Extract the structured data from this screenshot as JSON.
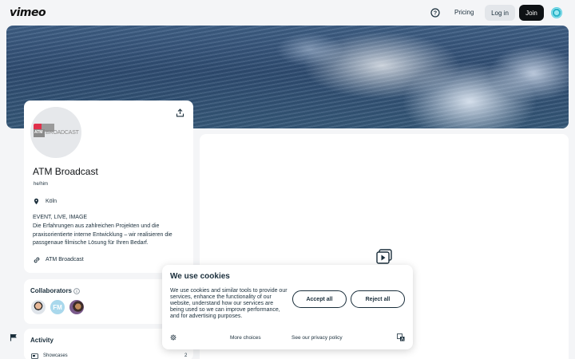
{
  "header": {
    "logo": "vimeo",
    "help_icon": "question-circle-icon",
    "pricing_label": "Pricing",
    "login_label": "Log in",
    "join_label": "Join",
    "avatar_icon": "user-avatar-icon"
  },
  "profile": {
    "logo_text": "BROADCAST",
    "logo_short": "ATM",
    "name": "ATM Broadcast",
    "pronouns": "he/him",
    "location": "Köln",
    "tagline": "EVENT, LIVE, IMAGE",
    "bio": "Die Erfahrungen aus zahlreichen Projekten und die praxisorientierte interne Entwicklung – wir realisieren die passgenaue filmische Lösung für Ihren Bedarf.",
    "website": "ATM Broadcast"
  },
  "collaborators": {
    "title": "Collaborators",
    "items": [
      {
        "initials": ""
      },
      {
        "initials": "FM"
      },
      {
        "initials": ""
      }
    ]
  },
  "activity": {
    "title": "Activity",
    "rows": [
      {
        "label": "Showcases",
        "count": "2"
      }
    ]
  },
  "cookie": {
    "title": "We use cookies",
    "text": "We use cookies and similar tools to provide our services, enhance the functionality of our website, understand how our services are being used so we can improve performance, and for advertising purposes.",
    "accept_label": "Accept all",
    "reject_label": "Reject all",
    "more_choices_label": "More choices",
    "privacy_label": "See our privacy policy"
  },
  "colors": {
    "brand_dark": "#0e1114",
    "accent_teal": "#2bb4c8",
    "atm_red": "#e0304b"
  }
}
